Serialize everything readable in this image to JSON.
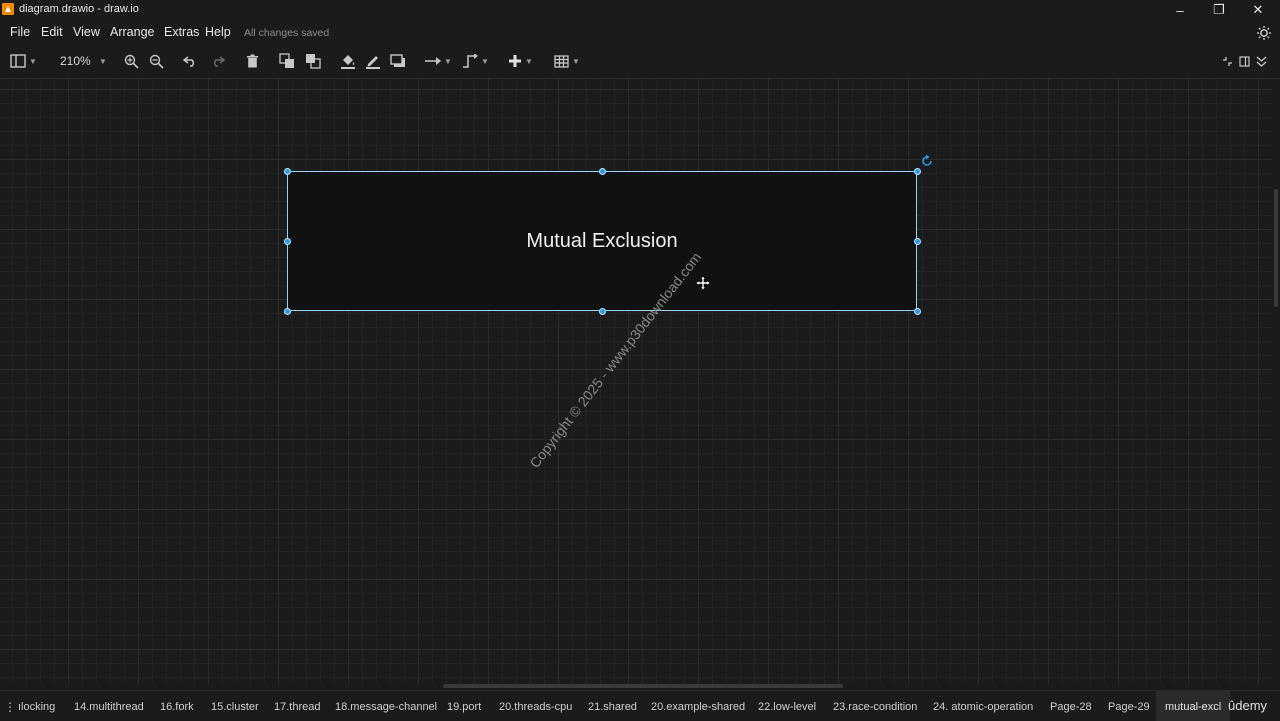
{
  "window": {
    "title": "diagram.drawio - draw.io",
    "minimize": "–",
    "maximize": "❐",
    "close": "✕"
  },
  "menu": {
    "items": [
      "File",
      "Edit",
      "View",
      "Arrange",
      "Extras",
      "Help"
    ],
    "status": "All changes saved"
  },
  "toolbar": {
    "zoom": "210%"
  },
  "diagram": {
    "shape_label": "Mutual Exclusion"
  },
  "watermark": "Copyright © 2025 - www.p30download.com",
  "tabs": [
    "ılocking",
    "14.multithread",
    "16.fork",
    "15.cluster",
    "17.thread",
    "18.message-channel",
    "19.port",
    "20.threads-cpu",
    "21.shared",
    "20.example-shared",
    "22.low-level",
    "23.race-condition",
    "24. atomic-operation",
    "Page-28",
    "Page-29",
    "mutual-excl"
  ],
  "active_tab": "mutual-excl",
  "pages_menu": "⋮",
  "brand": "ûdemy"
}
